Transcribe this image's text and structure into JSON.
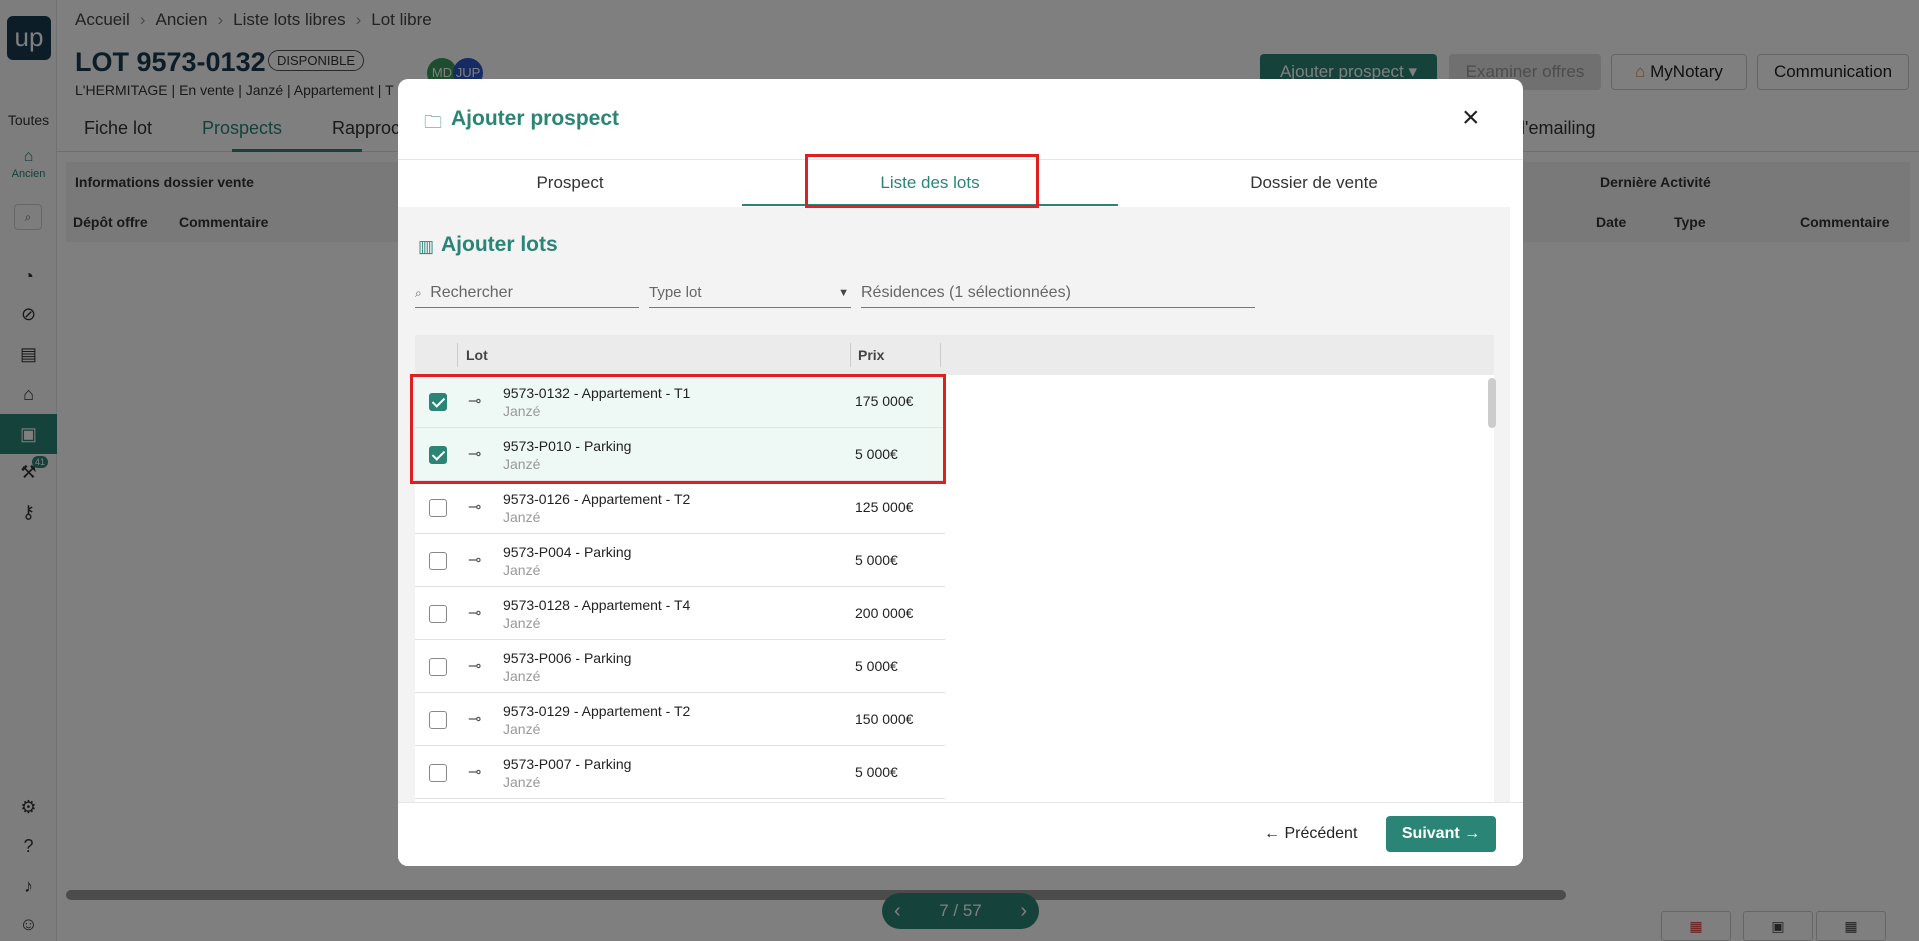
{
  "sidebar": {
    "logo": "up",
    "toutes_label": "Toutes",
    "ancien_label": "Ancien",
    "badge_count": "41"
  },
  "breadcrumb": [
    "Accueil",
    "Ancien",
    "Liste lots libres",
    "Lot libre"
  ],
  "header": {
    "title": "LOT 9573-0132",
    "status": "DISPONIBLE",
    "subline": "L'HERMITAGE | En vente | Janzé | Appartement | T",
    "avatars": [
      "MD",
      "JUP"
    ]
  },
  "actions": {
    "add_prospect": "Ajouter prospect",
    "examine_offers": "Examiner offres",
    "mynotary": "MyNotary",
    "communication": "Communication"
  },
  "main_tabs": [
    "Fiche lot",
    "Prospects",
    "Rapproch",
    "d'emailing"
  ],
  "table_headers": {
    "group_left": "Informations dossier vente",
    "col1": "Dépôt offre",
    "col2": "Commentaire",
    "group_right": "Dernière Activité",
    "col3": "Date",
    "col4": "Type",
    "col5": "Commentaire"
  },
  "pager": {
    "label": "7 / 57"
  },
  "modal": {
    "title": "Ajouter prospect",
    "tabs": [
      "Prospect",
      "Liste des lots",
      "Dossier de vente"
    ],
    "active_tab": "Liste des lots",
    "section_title": "Ajouter lots",
    "search_placeholder": "Rechercher",
    "type_lot_placeholder": "Type lot",
    "residences_label": "Résidences (1 sélectionnées)",
    "columns": {
      "lot": "Lot",
      "price": "Prix"
    },
    "rows": [
      {
        "name": "9573-0132 - Appartement - T1",
        "city": "Janzé",
        "price": "175 000€",
        "checked": true
      },
      {
        "name": "9573-P010 - Parking",
        "city": "Janzé",
        "price": "5 000€",
        "checked": true
      },
      {
        "name": "9573-0126 - Appartement - T2",
        "city": "Janzé",
        "price": "125 000€",
        "checked": false
      },
      {
        "name": "9573-P004 - Parking",
        "city": "Janzé",
        "price": "5 000€",
        "checked": false
      },
      {
        "name": "9573-0128 - Appartement - T4",
        "city": "Janzé",
        "price": "200 000€",
        "checked": false
      },
      {
        "name": "9573-P006 - Parking",
        "city": "Janzé",
        "price": "5 000€",
        "checked": false
      },
      {
        "name": "9573-0129 - Appartement - T2",
        "city": "Janzé",
        "price": "150 000€",
        "checked": false
      },
      {
        "name": "9573-P007 - Parking",
        "city": "Janzé",
        "price": "5 000€",
        "checked": false
      }
    ],
    "prev_label": "← Précédent",
    "next_label": "Suivant →"
  },
  "colors": {
    "accent": "#2a8577",
    "brand_dark": "#1a3a4f",
    "highlight": "#e02020"
  }
}
